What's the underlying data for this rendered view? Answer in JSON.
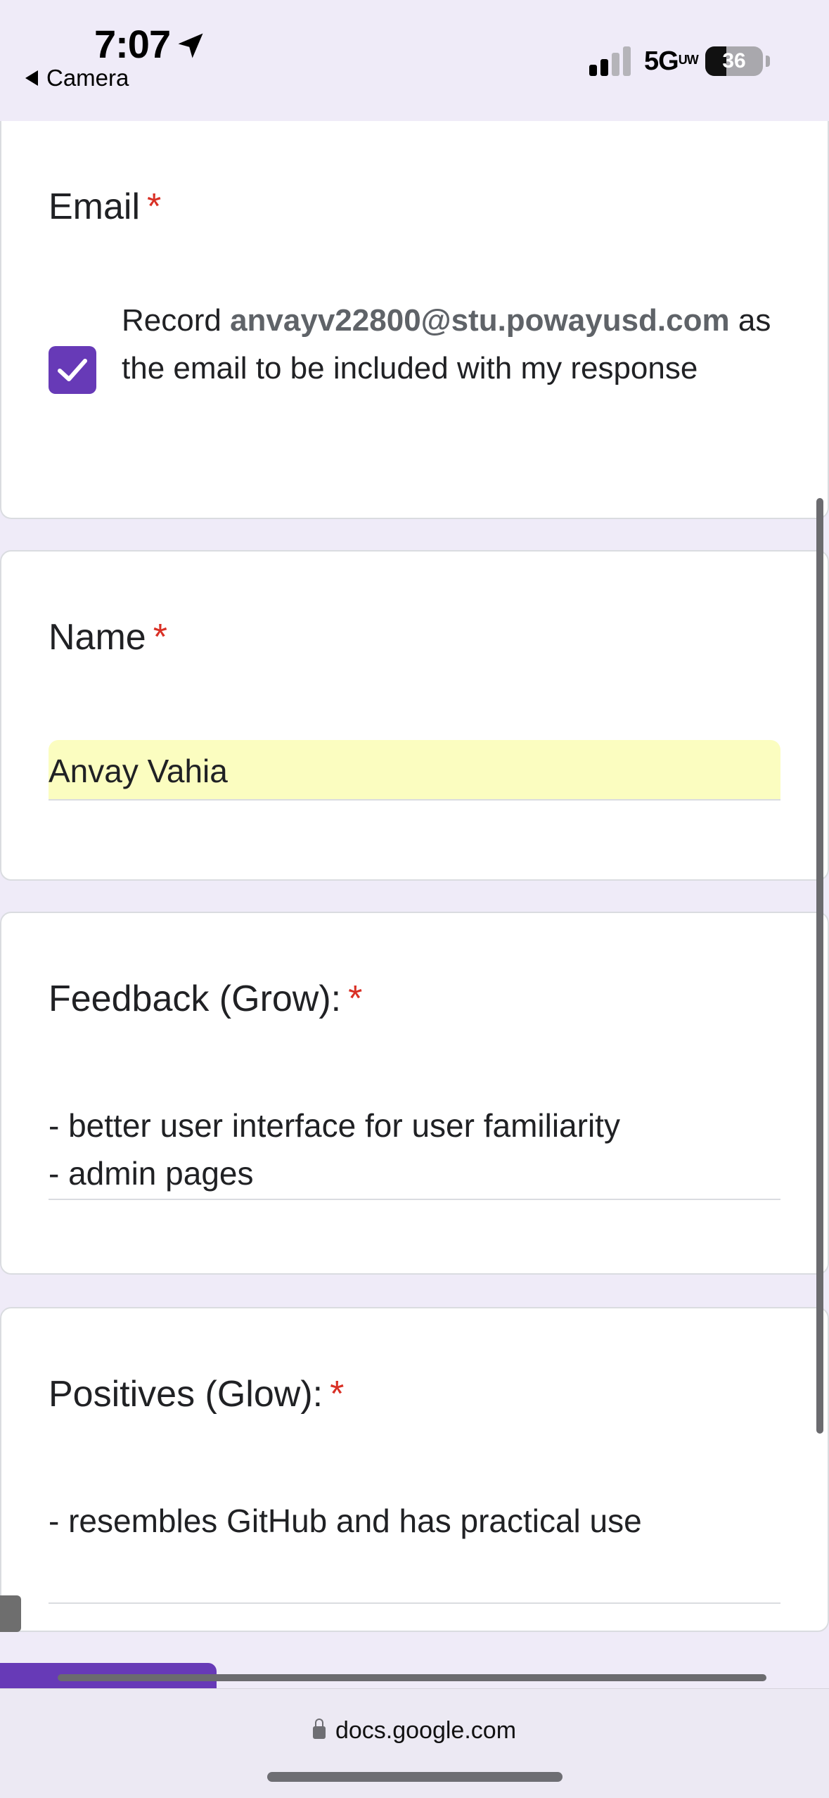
{
  "status_bar": {
    "time": "7:07",
    "back_app": "Camera",
    "network": "5G",
    "network_superscript": "UW",
    "battery_percent": "36",
    "battery_level": 0.36
  },
  "form": {
    "email_question": {
      "title": "Email",
      "required_mark": "*",
      "checkbox_checked": true,
      "record_prefix": "Record ",
      "email": "anvayv22800@stu.powayusd.com",
      "record_suffix": " as the email to be included with my response"
    },
    "name_question": {
      "title": "Name",
      "required_mark": "*",
      "answer": "Anvay Vahia"
    },
    "grow_question": {
      "title": "Feedback (Grow):",
      "required_mark": "*",
      "answer": "- better user interface for user familiarity\n- admin pages"
    },
    "glow_question": {
      "title": "Positives (Glow):",
      "required_mark": "*",
      "answer": "- resembles GitHub and has practical use"
    }
  },
  "browser": {
    "url": "docs.google.com"
  },
  "colors": {
    "accent": "#673ab7",
    "required": "#d93025",
    "autofill_highlight": "#fbfdc0",
    "background": "#efebf8"
  }
}
